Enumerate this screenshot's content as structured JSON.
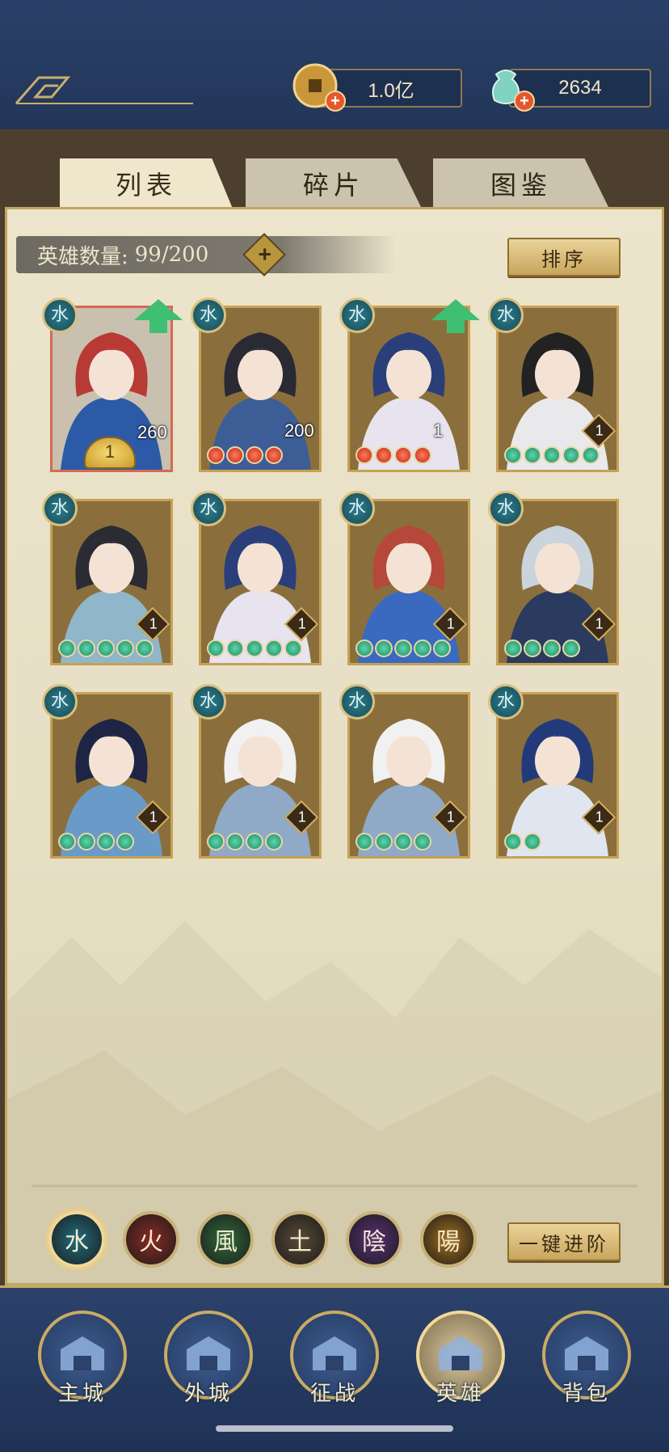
{
  "resources": {
    "coins": "1.0亿",
    "jade": "2634"
  },
  "tabs": [
    {
      "label": "列表",
      "active": true
    },
    {
      "label": "碎片",
      "active": false
    },
    {
      "label": "图鉴",
      "active": false
    }
  ],
  "hero_count": {
    "label": "英雄数量:",
    "value": "99/200"
  },
  "sort_label": "排序",
  "heroes": [
    {
      "element": "水",
      "level": "260",
      "frame": "red",
      "arrow": true,
      "stars": 1,
      "star_color": "gold",
      "art": "red-hair-warrior"
    },
    {
      "element": "水",
      "level": "200",
      "frame": "gold",
      "arrow": false,
      "stars": 4,
      "star_color": "red",
      "art": "dark-armored-man"
    },
    {
      "element": "水",
      "level": "1",
      "frame": "gold",
      "arrow": true,
      "stars": 4,
      "star_color": "red",
      "art": "opera-blue-heroine"
    },
    {
      "element": "水",
      "level": "1",
      "frame": "gold",
      "arrow": false,
      "stars": 5,
      "star_color": "green",
      "art": "veiled-lady"
    },
    {
      "element": "水",
      "level": "1",
      "frame": "gold",
      "arrow": false,
      "stars": 5,
      "star_color": "green",
      "art": "black-hair-maiden"
    },
    {
      "element": "水",
      "level": "1",
      "frame": "gold",
      "arrow": false,
      "stars": 5,
      "star_color": "green",
      "art": "opera-blue-heroine"
    },
    {
      "element": "水",
      "level": "1",
      "frame": "gold",
      "arrow": false,
      "stars": 5,
      "star_color": "green",
      "art": "red-hair-gold-hat"
    },
    {
      "element": "水",
      "level": "1",
      "frame": "gold",
      "arrow": false,
      "stars": 4,
      "star_color": "green",
      "art": "silver-hair-knight"
    },
    {
      "element": "水",
      "level": "1",
      "frame": "gold",
      "arrow": false,
      "stars": 4,
      "star_color": "green",
      "art": "flower-maiden"
    },
    {
      "element": "水",
      "level": "1",
      "frame": "gold",
      "arrow": false,
      "stars": 4,
      "star_color": "green",
      "art": "white-hat-lady"
    },
    {
      "element": "水",
      "level": "1",
      "frame": "gold",
      "arrow": false,
      "stars": 4,
      "star_color": "green",
      "art": "white-hat-lady"
    },
    {
      "element": "水",
      "level": "1",
      "frame": "gold",
      "arrow": false,
      "stars": 2,
      "star_color": "green",
      "art": "blue-hair-youth"
    }
  ],
  "element_filters": [
    {
      "glyph": "水",
      "name": "water",
      "color": "#1f6e7d",
      "selected": true
    },
    {
      "glyph": "火",
      "name": "fire",
      "color": "#8a2a22",
      "selected": false
    },
    {
      "glyph": "風",
      "name": "wind",
      "color": "#2f6b3a",
      "selected": false
    },
    {
      "glyph": "土",
      "name": "earth",
      "color": "#5a4a35",
      "selected": false
    },
    {
      "glyph": "陰",
      "name": "yin",
      "color": "#5a2f7a",
      "selected": false
    },
    {
      "glyph": "陽",
      "name": "yang",
      "color": "#a36d1a",
      "selected": false
    }
  ],
  "advance_all_label": "一键进阶",
  "nav": [
    {
      "label": "主城",
      "icon": "palace-icon"
    },
    {
      "label": "外城",
      "icon": "city-gate-icon"
    },
    {
      "label": "征战",
      "icon": "war-drum-icon"
    },
    {
      "label": "英雄",
      "icon": "hero-portrait-icon",
      "active": true
    },
    {
      "label": "背包",
      "icon": "bag-icon"
    }
  ]
}
